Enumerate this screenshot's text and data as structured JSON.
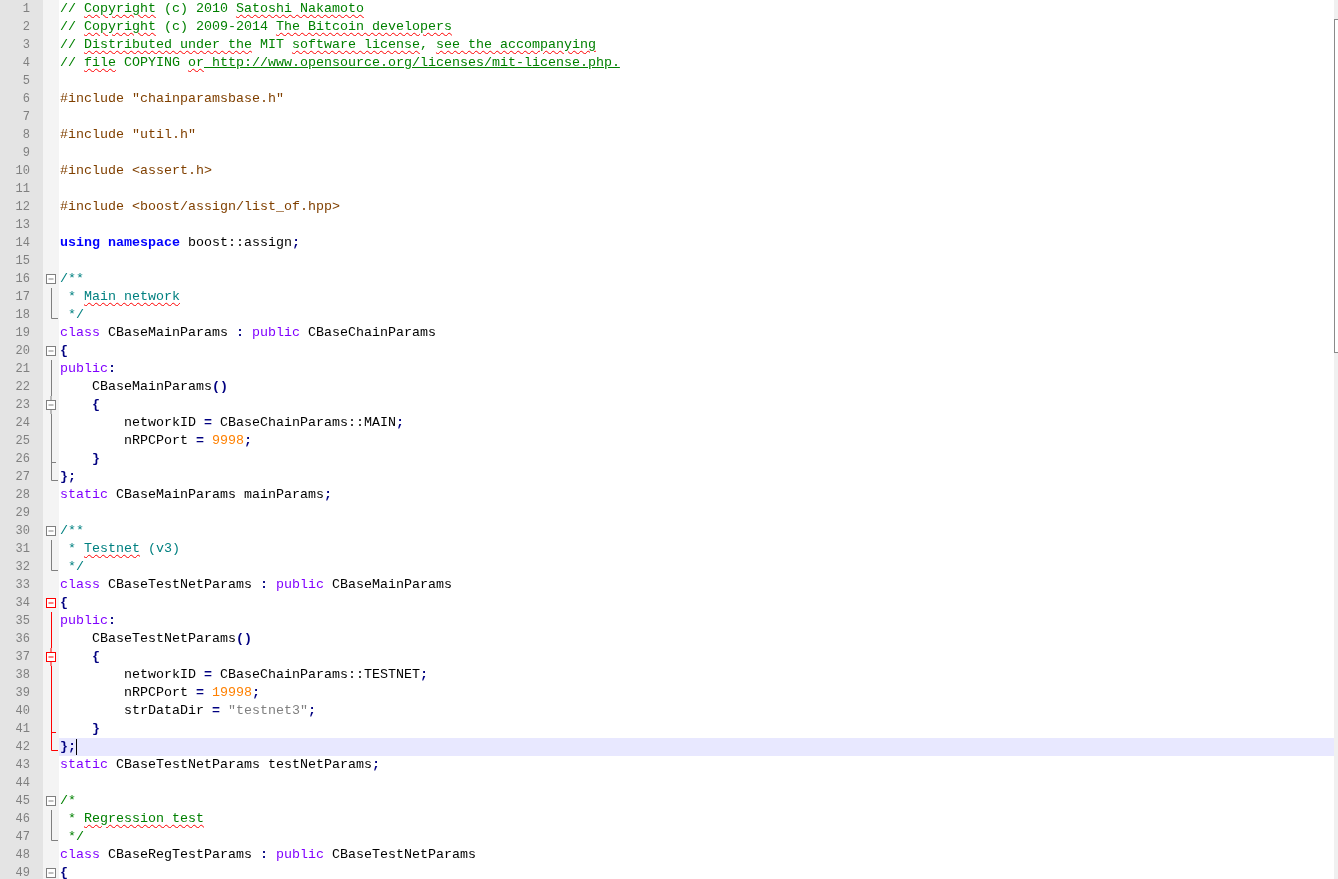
{
  "lines": [
    {
      "number": "1",
      "tokens": [
        {
          "kind": "comment",
          "text": "// "
        },
        {
          "kind": "comment_typo",
          "text": "Copyright"
        },
        {
          "kind": "comment",
          "text": " (c) 2010 "
        },
        {
          "kind": "comment_typo",
          "text": "Satoshi Nakamoto"
        }
      ]
    },
    {
      "number": "2",
      "tokens": [
        {
          "kind": "comment",
          "text": "// "
        },
        {
          "kind": "comment_typo",
          "text": "Copyright"
        },
        {
          "kind": "comment",
          "text": " (c) 2009-2014 "
        },
        {
          "kind": "comment_typo",
          "text": "The Bitcoin developers"
        }
      ]
    },
    {
      "number": "3",
      "tokens": [
        {
          "kind": "comment",
          "text": "// "
        },
        {
          "kind": "comment_typo",
          "text": "Distributed under the"
        },
        {
          "kind": "comment",
          "text": " MIT "
        },
        {
          "kind": "comment_typo",
          "text": "software license"
        },
        {
          "kind": "comment",
          "text": ", "
        },
        {
          "kind": "comment_typo",
          "text": "see the accompanying"
        }
      ]
    },
    {
      "number": "4",
      "tokens": [
        {
          "kind": "comment",
          "text": "// "
        },
        {
          "kind": "comment_typo",
          "text": "file"
        },
        {
          "kind": "comment",
          "text": " COPYING "
        },
        {
          "kind": "comment_typo",
          "text": "or"
        },
        {
          "kind": "comment_url",
          "text": " http://www.opensource.org/licenses/mit-license.php."
        }
      ]
    },
    {
      "number": "5"
    },
    {
      "number": "6",
      "tokens": [
        {
          "kind": "preprocessor",
          "text": "#include \"chainparamsbase.h\""
        }
      ]
    },
    {
      "number": "7"
    },
    {
      "number": "8",
      "tokens": [
        {
          "kind": "preprocessor",
          "text": "#include \"util.h\""
        }
      ]
    },
    {
      "number": "9"
    },
    {
      "number": "10",
      "tokens": [
        {
          "kind": "preprocessor",
          "text": "#include <assert.h>"
        }
      ]
    },
    {
      "number": "11"
    },
    {
      "number": "12",
      "tokens": [
        {
          "kind": "preprocessor",
          "text": "#include <boost/assign/list_of.hpp>"
        }
      ]
    },
    {
      "number": "13"
    },
    {
      "number": "14",
      "tokens": [
        {
          "kind": "keyword",
          "text": "using"
        },
        {
          "kind": "keyword",
          "text": " namespace"
        },
        {
          "kind": "plain",
          "text": " boost::assign"
        },
        {
          "kind": "operator",
          "text": ";"
        }
      ]
    },
    {
      "number": "15"
    },
    {
      "number": "16",
      "fold": {
        "kind": "box",
        "active": false
      },
      "tokens": [
        {
          "kind": "doc",
          "text": "/**"
        }
      ]
    },
    {
      "number": "17",
      "fold": {
        "kind": "line",
        "active": false
      },
      "tokens": [
        {
          "kind": "doc",
          "text": " * "
        },
        {
          "kind": "doc_typo",
          "text": "Main network"
        }
      ]
    },
    {
      "number": "18",
      "fold": {
        "kind": "corner",
        "active": false
      },
      "tokens": [
        {
          "kind": "doc",
          "text": " */"
        }
      ]
    },
    {
      "number": "19",
      "tokens": [
        {
          "kind": "type",
          "text": "class"
        },
        {
          "kind": "plain",
          "text": " CBaseMainParams "
        },
        {
          "kind": "operator",
          "text": ":"
        },
        {
          "kind": "type",
          "text": " public"
        },
        {
          "kind": "plain",
          "text": " CBaseChainParams"
        }
      ]
    },
    {
      "number": "20",
      "fold": {
        "kind": "box",
        "active": false
      },
      "tokens": [
        {
          "kind": "operator",
          "text": "{"
        }
      ]
    },
    {
      "number": "21",
      "fold": {
        "kind": "line",
        "active": false
      },
      "tokens": [
        {
          "kind": "type",
          "text": "public"
        },
        {
          "kind": "operator",
          "text": ":"
        }
      ]
    },
    {
      "number": "22",
      "fold": {
        "kind": "line",
        "active": false
      },
      "tokens": [
        {
          "kind": "plain",
          "text": "    CBaseMainParams"
        },
        {
          "kind": "operator",
          "text": "()"
        }
      ]
    },
    {
      "number": "23",
      "fold": {
        "kind": "nested_box",
        "active": false
      },
      "tokens": [
        {
          "kind": "operator",
          "text": "    {"
        }
      ]
    },
    {
      "number": "24",
      "fold": {
        "kind": "line",
        "active": false
      },
      "tokens": [
        {
          "kind": "plain",
          "text": "        networkID "
        },
        {
          "kind": "operator",
          "text": "="
        },
        {
          "kind": "plain",
          "text": " CBaseChainParams::MAIN"
        },
        {
          "kind": "operator",
          "text": ";"
        }
      ]
    },
    {
      "number": "25",
      "fold": {
        "kind": "line",
        "active": false
      },
      "tokens": [
        {
          "kind": "plain",
          "text": "        nRPCPort "
        },
        {
          "kind": "operator",
          "text": "="
        },
        {
          "kind": "number",
          "text": " 9998"
        },
        {
          "kind": "operator",
          "text": ";"
        }
      ]
    },
    {
      "number": "26",
      "fold": {
        "kind": "tee",
        "active": false
      },
      "tokens": [
        {
          "kind": "operator",
          "text": "    }"
        }
      ]
    },
    {
      "number": "27",
      "fold": {
        "kind": "corner",
        "active": false
      },
      "tokens": [
        {
          "kind": "operator",
          "text": "};"
        }
      ]
    },
    {
      "number": "28",
      "tokens": [
        {
          "kind": "type",
          "text": "static"
        },
        {
          "kind": "plain",
          "text": " CBaseMainParams mainParams"
        },
        {
          "kind": "operator",
          "text": ";"
        }
      ]
    },
    {
      "number": "29"
    },
    {
      "number": "30",
      "fold": {
        "kind": "box",
        "active": false
      },
      "tokens": [
        {
          "kind": "doc",
          "text": "/**"
        }
      ]
    },
    {
      "number": "31",
      "fold": {
        "kind": "line",
        "active": false
      },
      "tokens": [
        {
          "kind": "doc",
          "text": " * "
        },
        {
          "kind": "doc_typo",
          "text": "Testnet"
        },
        {
          "kind": "doc",
          "text": " (v3)"
        }
      ]
    },
    {
      "number": "32",
      "fold": {
        "kind": "corner",
        "active": false
      },
      "tokens": [
        {
          "kind": "doc",
          "text": " */"
        }
      ]
    },
    {
      "number": "33",
      "tokens": [
        {
          "kind": "type",
          "text": "class"
        },
        {
          "kind": "plain",
          "text": " CBaseTestNetParams "
        },
        {
          "kind": "operator",
          "text": ":"
        },
        {
          "kind": "type",
          "text": " public"
        },
        {
          "kind": "plain",
          "text": " CBaseMainParams"
        }
      ]
    },
    {
      "number": "34",
      "fold": {
        "kind": "box",
        "active": true
      },
      "tokens": [
        {
          "kind": "operator",
          "text": "{"
        }
      ]
    },
    {
      "number": "35",
      "fold": {
        "kind": "line",
        "active": true
      },
      "tokens": [
        {
          "kind": "type",
          "text": "public"
        },
        {
          "kind": "operator",
          "text": ":"
        }
      ]
    },
    {
      "number": "36",
      "fold": {
        "kind": "line",
        "active": true
      },
      "tokens": [
        {
          "kind": "plain",
          "text": "    CBaseTestNetParams"
        },
        {
          "kind": "operator",
          "text": "()"
        }
      ]
    },
    {
      "number": "37",
      "fold": {
        "kind": "nested_box",
        "active": true
      },
      "tokens": [
        {
          "kind": "operator",
          "text": "    {"
        }
      ]
    },
    {
      "number": "38",
      "fold": {
        "kind": "line",
        "active": true
      },
      "tokens": [
        {
          "kind": "plain",
          "text": "        networkID "
        },
        {
          "kind": "operator",
          "text": "="
        },
        {
          "kind": "plain",
          "text": " CBaseChainParams::TESTNET"
        },
        {
          "kind": "operator",
          "text": ";"
        }
      ]
    },
    {
      "number": "39",
      "fold": {
        "kind": "line",
        "active": true
      },
      "tokens": [
        {
          "kind": "plain",
          "text": "        nRPCPort "
        },
        {
          "kind": "operator",
          "text": "="
        },
        {
          "kind": "number",
          "text": " 19998"
        },
        {
          "kind": "operator",
          "text": ";"
        }
      ]
    },
    {
      "number": "40",
      "fold": {
        "kind": "line",
        "active": true
      },
      "tokens": [
        {
          "kind": "plain",
          "text": "        strDataDir "
        },
        {
          "kind": "operator",
          "text": "="
        },
        {
          "kind": "string",
          "text": " \"testnet3\""
        },
        {
          "kind": "operator",
          "text": ";"
        }
      ]
    },
    {
      "number": "41",
      "fold": {
        "kind": "tee",
        "active": true
      },
      "tokens": [
        {
          "kind": "operator",
          "text": "    }"
        }
      ]
    },
    {
      "number": "42",
      "current": true,
      "fold": {
        "kind": "corner",
        "active": true
      },
      "tokens": [
        {
          "kind": "operator",
          "text": "};"
        }
      ]
    },
    {
      "number": "43",
      "tokens": [
        {
          "kind": "type",
          "text": "static"
        },
        {
          "kind": "plain",
          "text": " CBaseTestNetParams testNetParams"
        },
        {
          "kind": "operator",
          "text": ";"
        }
      ]
    },
    {
      "number": "44"
    },
    {
      "number": "45",
      "fold": {
        "kind": "box",
        "active": false
      },
      "tokens": [
        {
          "kind": "comment",
          "text": "/*"
        }
      ]
    },
    {
      "number": "46",
      "fold": {
        "kind": "line",
        "active": false
      },
      "tokens": [
        {
          "kind": "comment",
          "text": " * "
        },
        {
          "kind": "comment_typo",
          "text": "Regression test"
        }
      ]
    },
    {
      "number": "47",
      "fold": {
        "kind": "corner",
        "active": false
      },
      "tokens": [
        {
          "kind": "comment",
          "text": " */"
        }
      ]
    },
    {
      "number": "48",
      "tokens": [
        {
          "kind": "type",
          "text": "class"
        },
        {
          "kind": "plain",
          "text": " CBaseRegTestParams "
        },
        {
          "kind": "operator",
          "text": ":"
        },
        {
          "kind": "type",
          "text": " public"
        },
        {
          "kind": "plain",
          "text": " CBaseTestNetParams"
        }
      ]
    },
    {
      "number": "49",
      "fold": {
        "kind": "box",
        "active": false
      },
      "tokens": [
        {
          "kind": "operator",
          "text": "{"
        }
      ]
    }
  ]
}
